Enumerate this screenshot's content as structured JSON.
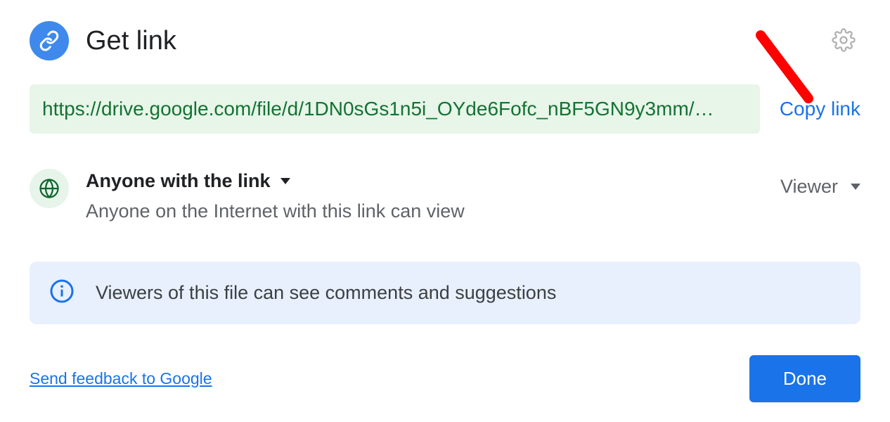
{
  "header": {
    "title": "Get link"
  },
  "url": {
    "value": "https://drive.google.com/file/d/1DN0sGs1n5i_OYde6Fofc_nBF5GN9y3mm/…",
    "copy_label": "Copy link"
  },
  "scope": {
    "select_label": "Anyone with the link",
    "description": "Anyone on the Internet with this link can view"
  },
  "role": {
    "select_label": "Viewer"
  },
  "info": {
    "text": "Viewers of this file can see comments and suggestions"
  },
  "footer": {
    "feedback_label": "Send feedback to Google",
    "done_label": "Done"
  },
  "colors": {
    "accent": "#1a73e8",
    "url_bg": "#e8f5e9",
    "url_text": "#137333",
    "info_bg": "#e8f0fe",
    "arrow": "#ff0000"
  }
}
